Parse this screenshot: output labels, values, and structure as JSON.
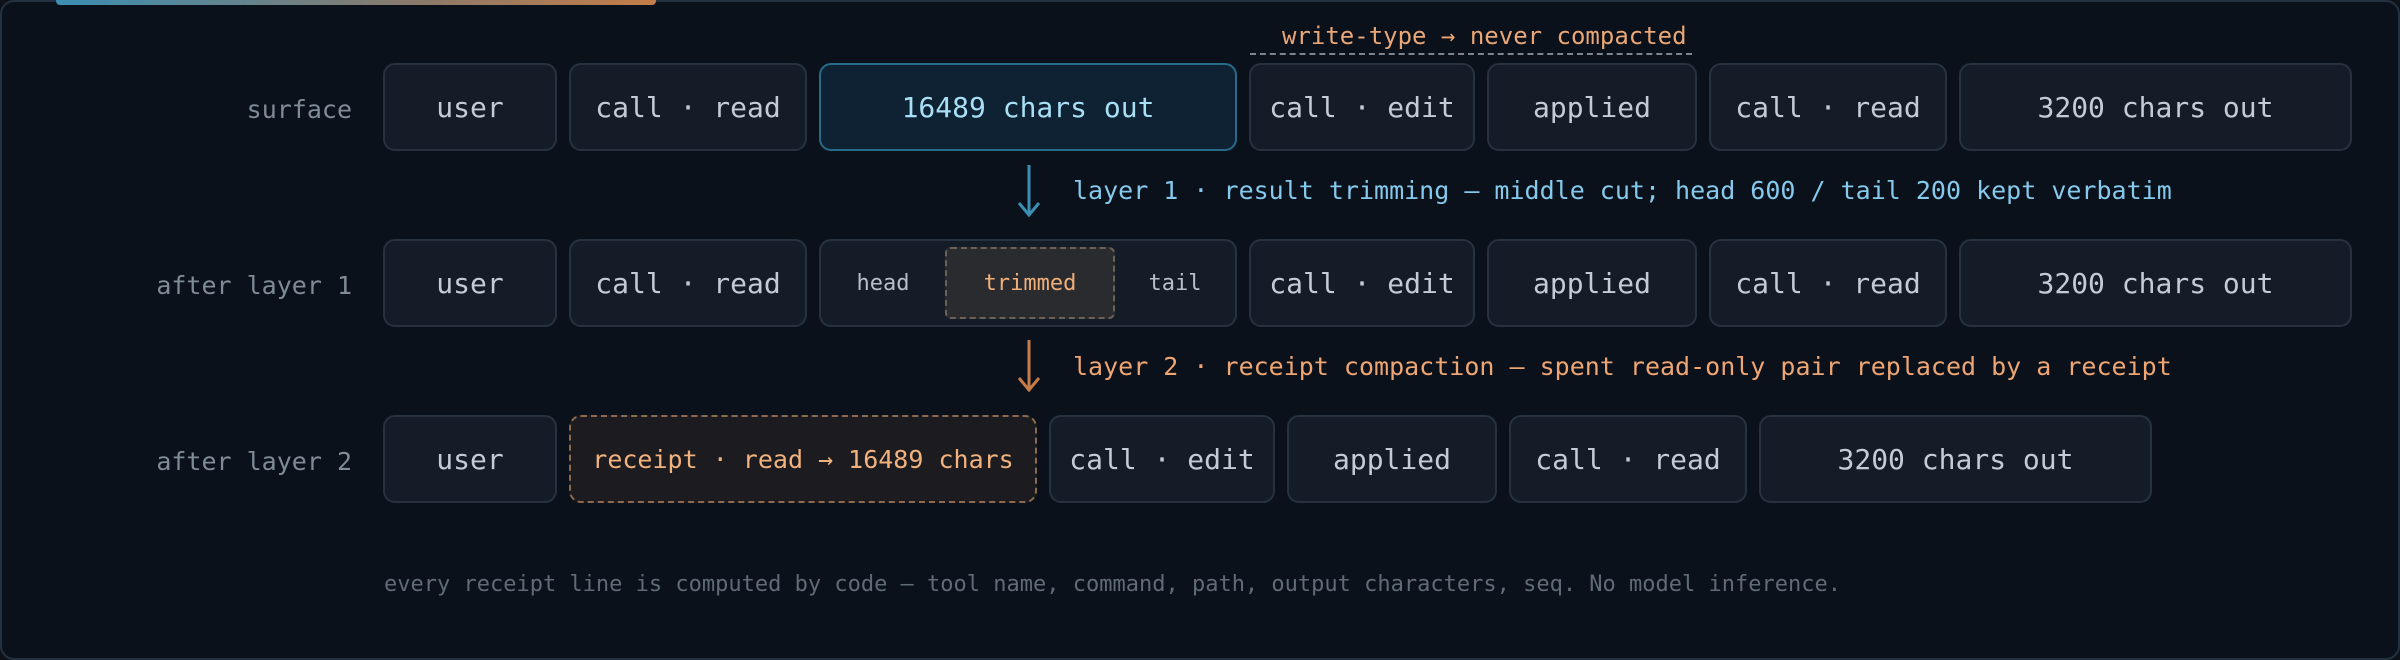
{
  "rows": {
    "surface": {
      "label": "surface",
      "items": [
        "user",
        "call · read",
        "16489 chars out",
        "call · edit",
        "applied",
        "call · read",
        "3200 chars out"
      ]
    },
    "layer1": {
      "label": "after layer 1",
      "items": [
        "user",
        "call · read",
        "call · edit",
        "applied",
        "call · read",
        "3200 chars out"
      ],
      "split": {
        "head": "head",
        "trimmed": "trimmed",
        "tail": "tail"
      }
    },
    "layer2": {
      "label": "after layer 2",
      "items": [
        "user",
        "receipt · read → 16489 chars",
        "call · edit",
        "applied",
        "call · read",
        "3200 chars out"
      ]
    }
  },
  "annotation": "write-type → never compacted",
  "steps": {
    "layer1": "layer 1 · result trimming — middle cut; head 600 / tail 200 kept verbatim",
    "layer2": "layer 2 · receipt compaction — spent read-only pair replaced by a receipt"
  },
  "footer": "every receipt line is computed by code — tool name, command, path, output characters, seq. No model inference.",
  "colors": {
    "background": "#0b111a",
    "box": "#141d27",
    "highlight_blue": "#85c9ec",
    "highlight_orange": "#eda573"
  }
}
